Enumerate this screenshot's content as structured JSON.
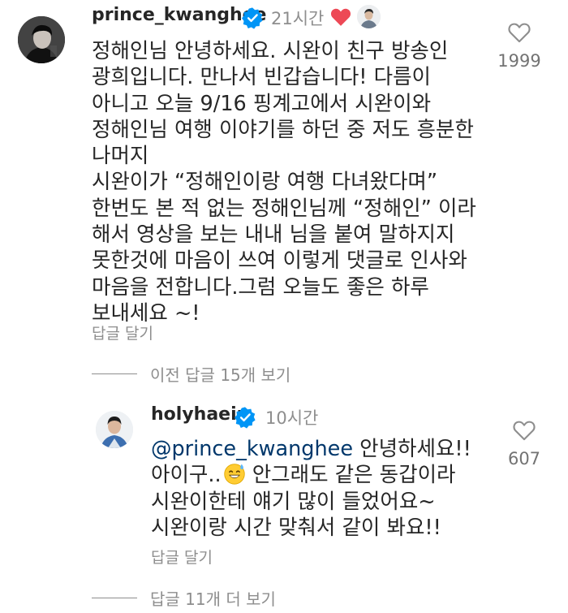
{
  "comment": {
    "username": "prince_kwanghee",
    "time": "21시간",
    "lines": [
      "정해인님 안녕하세요. 시완이 친구 방송인",
      "광희입니다. 만나서 빈갑습니다! 다름이",
      "아니고 오늘 9/16 핑계고에서 시완이와",
      "정해인님 여행 이야기를 하던 중 저도 흥분한",
      "나머지",
      "시완이가 “정해인이랑 여행 다녀왔다며”",
      "한번도 본 적 없는 정해인님께 “정해인” 이라",
      "해서 영상을 보는 내내 님을 붙여 말하지지",
      "못한것에 마음이 쓰여 이렇게 댓글로 인사와",
      "마음을 전합니다.그럼 오늘도 좋은 하루",
      "보내세요 ~!"
    ],
    "reply_label": "답글 달기",
    "like_count": "1999"
  },
  "view_previous": {
    "label": "이전 답글 15개 보기"
  },
  "reply": {
    "username": "holyhaein",
    "time": "10시간",
    "mention": "@prince_kwanghee",
    "line1_rest": " 안녕하세요!!",
    "line2_before": "아이구..",
    "line2_after": " 안그래도 같은 동갑이라",
    "line3": "시완이한테 얘기 많이 들었어요~",
    "line4": "시완이랑 시간 맞춰서 같이 봐요!!",
    "reply_label": "답글 달기",
    "like_count": "607"
  },
  "view_more": {
    "label": "답글 11개 더 보기"
  },
  "icons": {
    "verified_color": "#0095f6",
    "heart_red": "#ed4956",
    "heart_outline": "#8e8e8e"
  }
}
